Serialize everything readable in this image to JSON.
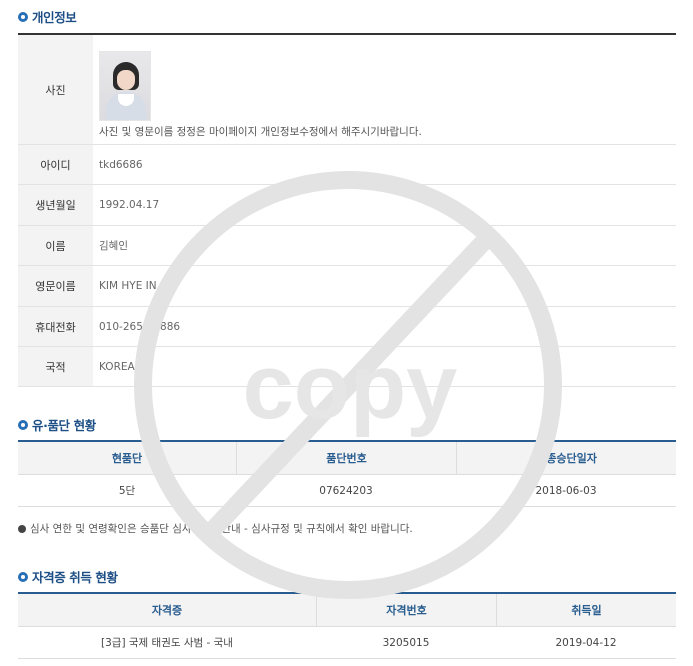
{
  "personal": {
    "title": "개인정보",
    "rows": [
      {
        "label": "사진",
        "value": "사진 및 영문이름 정정은 마이페이지 개인정보수정에서 해주시기바랍니다."
      },
      {
        "label": "아이디",
        "value": "tkd6686"
      },
      {
        "label": "생년월일",
        "value": "1992.04.17"
      },
      {
        "label": "이름",
        "value": "김혜인"
      },
      {
        "label": "영문이름",
        "value": "KIM HYE IN"
      },
      {
        "label": "휴대전화",
        "value": "010-2659-1886"
      },
      {
        "label": "국적",
        "value": "KOREAN"
      }
    ]
  },
  "grade": {
    "title": "유·품단 현황",
    "headers": [
      "현품단",
      "품단번호",
      "최종승단일자"
    ],
    "rows": [
      [
        "5단",
        "07624203",
        "2018-06-03"
      ]
    ]
  },
  "notice": "심사 연한 및 연령확인은 승품단 심사 - 심사안내 - 심사규정 및 규칙에서 확인 바랍니다.",
  "cert": {
    "title": "자격증 취득 현황",
    "headers": [
      "자격증",
      "자격번호",
      "취득일"
    ],
    "rows": [
      [
        "[3급] 국제 태권도 사범 - 국내",
        "3205015",
        "2019-04-12"
      ]
    ]
  },
  "watermark": "copy",
  "colors": {
    "accent": "#2a5d8f",
    "watermark": "#e6e6e6"
  }
}
